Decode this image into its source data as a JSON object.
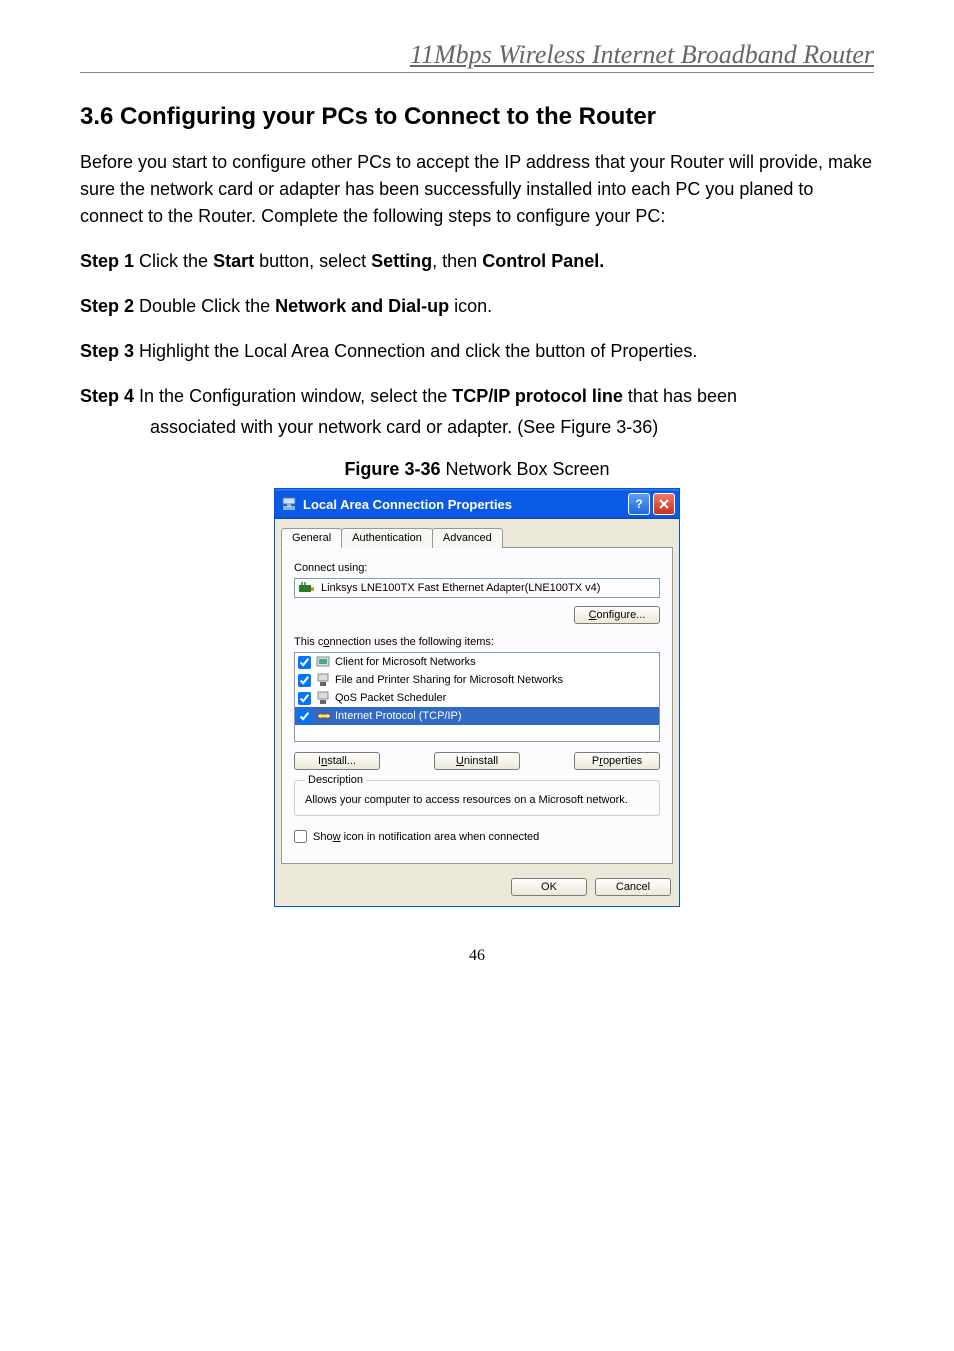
{
  "header": {
    "doc_title": "11Mbps Wireless Internet Broadband Router"
  },
  "section": {
    "heading": "3.6 Configuring your PCs to Connect to the Router",
    "intro": "Before you start to configure other PCs to accept the IP address that your Router will provide, make sure the network card or adapter has been successfully installed into each PC you planed to connect to the Router. Complete the following steps to configure your PC:",
    "steps": {
      "s1_prefix": "Step 1",
      "s1_body_a": " Click the ",
      "s1_bold_a": "Start",
      "s1_body_b": " button, select ",
      "s1_bold_b": "Setting",
      "s1_body_c": ", then ",
      "s1_bold_c": "Control Panel.",
      "s2_prefix": "Step 2",
      "s2_body_a": " Double Click the ",
      "s2_bold_a": "Network and Dial-up",
      "s2_body_b": " icon.",
      "s3_prefix": "Step 3",
      "s3_body": " Highlight the Local Area Connection and click the button of Properties.",
      "s4_prefix": "Step 4",
      "s4_body_a": " In the Configuration window, select the ",
      "s4_bold_a": "TCP/IP protocol line",
      "s4_body_b": " that has been",
      "s4_line2": "associated with your network card or adapter. (See Figure 3-36)"
    },
    "figure_caption_bold": "Figure 3-36",
    "figure_caption_rest": " Network Box Screen"
  },
  "dialog": {
    "title": "Local Area Connection Properties",
    "tabs": {
      "general": "General",
      "auth": "Authentication",
      "adv": "Advanced"
    },
    "connect_label": "Connect using:",
    "adapter": "Linksys LNE100TX Fast Ethernet Adapter(LNE100TX v4)",
    "configure_btn": "Configure...",
    "items_label": "This connection uses the following items:",
    "items": [
      {
        "label": "Client for Microsoft Networks"
      },
      {
        "label": "File and Printer Sharing for Microsoft Networks"
      },
      {
        "label": "QoS Packet Scheduler"
      },
      {
        "label": "Internet Protocol (TCP/IP)"
      }
    ],
    "install_btn": "Install...",
    "uninstall_btn": "Uninstall",
    "properties_btn": "Properties",
    "desc_legend": "Description",
    "desc_text": "Allows your computer to access resources on a Microsoft network.",
    "show_icon_label": "Show icon in notification area when connected",
    "ok_btn": "OK",
    "cancel_btn": "Cancel"
  },
  "page_number": "46"
}
